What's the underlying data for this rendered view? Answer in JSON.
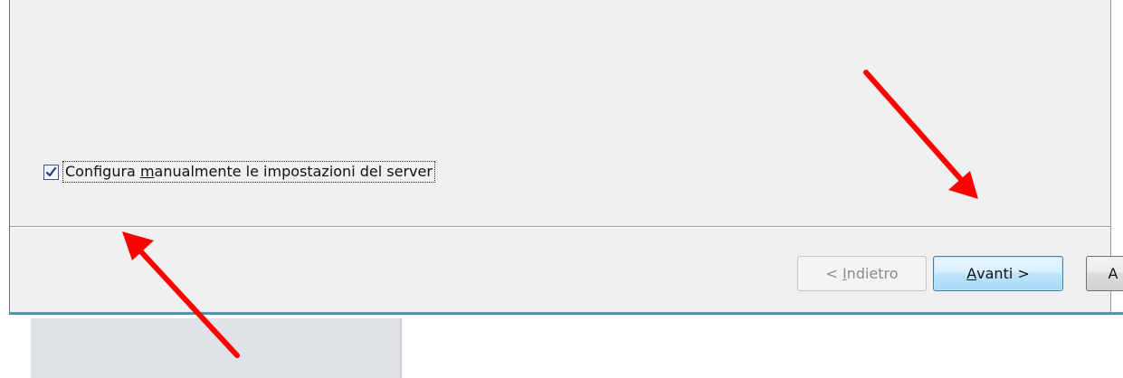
{
  "dialog": {
    "checkbox": {
      "checked": true,
      "label_before": "Configura ",
      "label_accel": "m",
      "label_after": "anualmente le impostazioni del server"
    },
    "buttons": {
      "back": {
        "prefix": "< ",
        "accel": "I",
        "rest": "ndietro",
        "enabled": false
      },
      "next": {
        "accel": "A",
        "rest": "vanti >",
        "enabled": true,
        "focused": true
      },
      "cancel": {
        "visible_text": "A"
      }
    }
  },
  "annotations": {
    "arrow_color": "#ff0000",
    "arrows": [
      {
        "name": "arrow-to-next-button"
      },
      {
        "name": "arrow-to-checkbox"
      }
    ]
  }
}
